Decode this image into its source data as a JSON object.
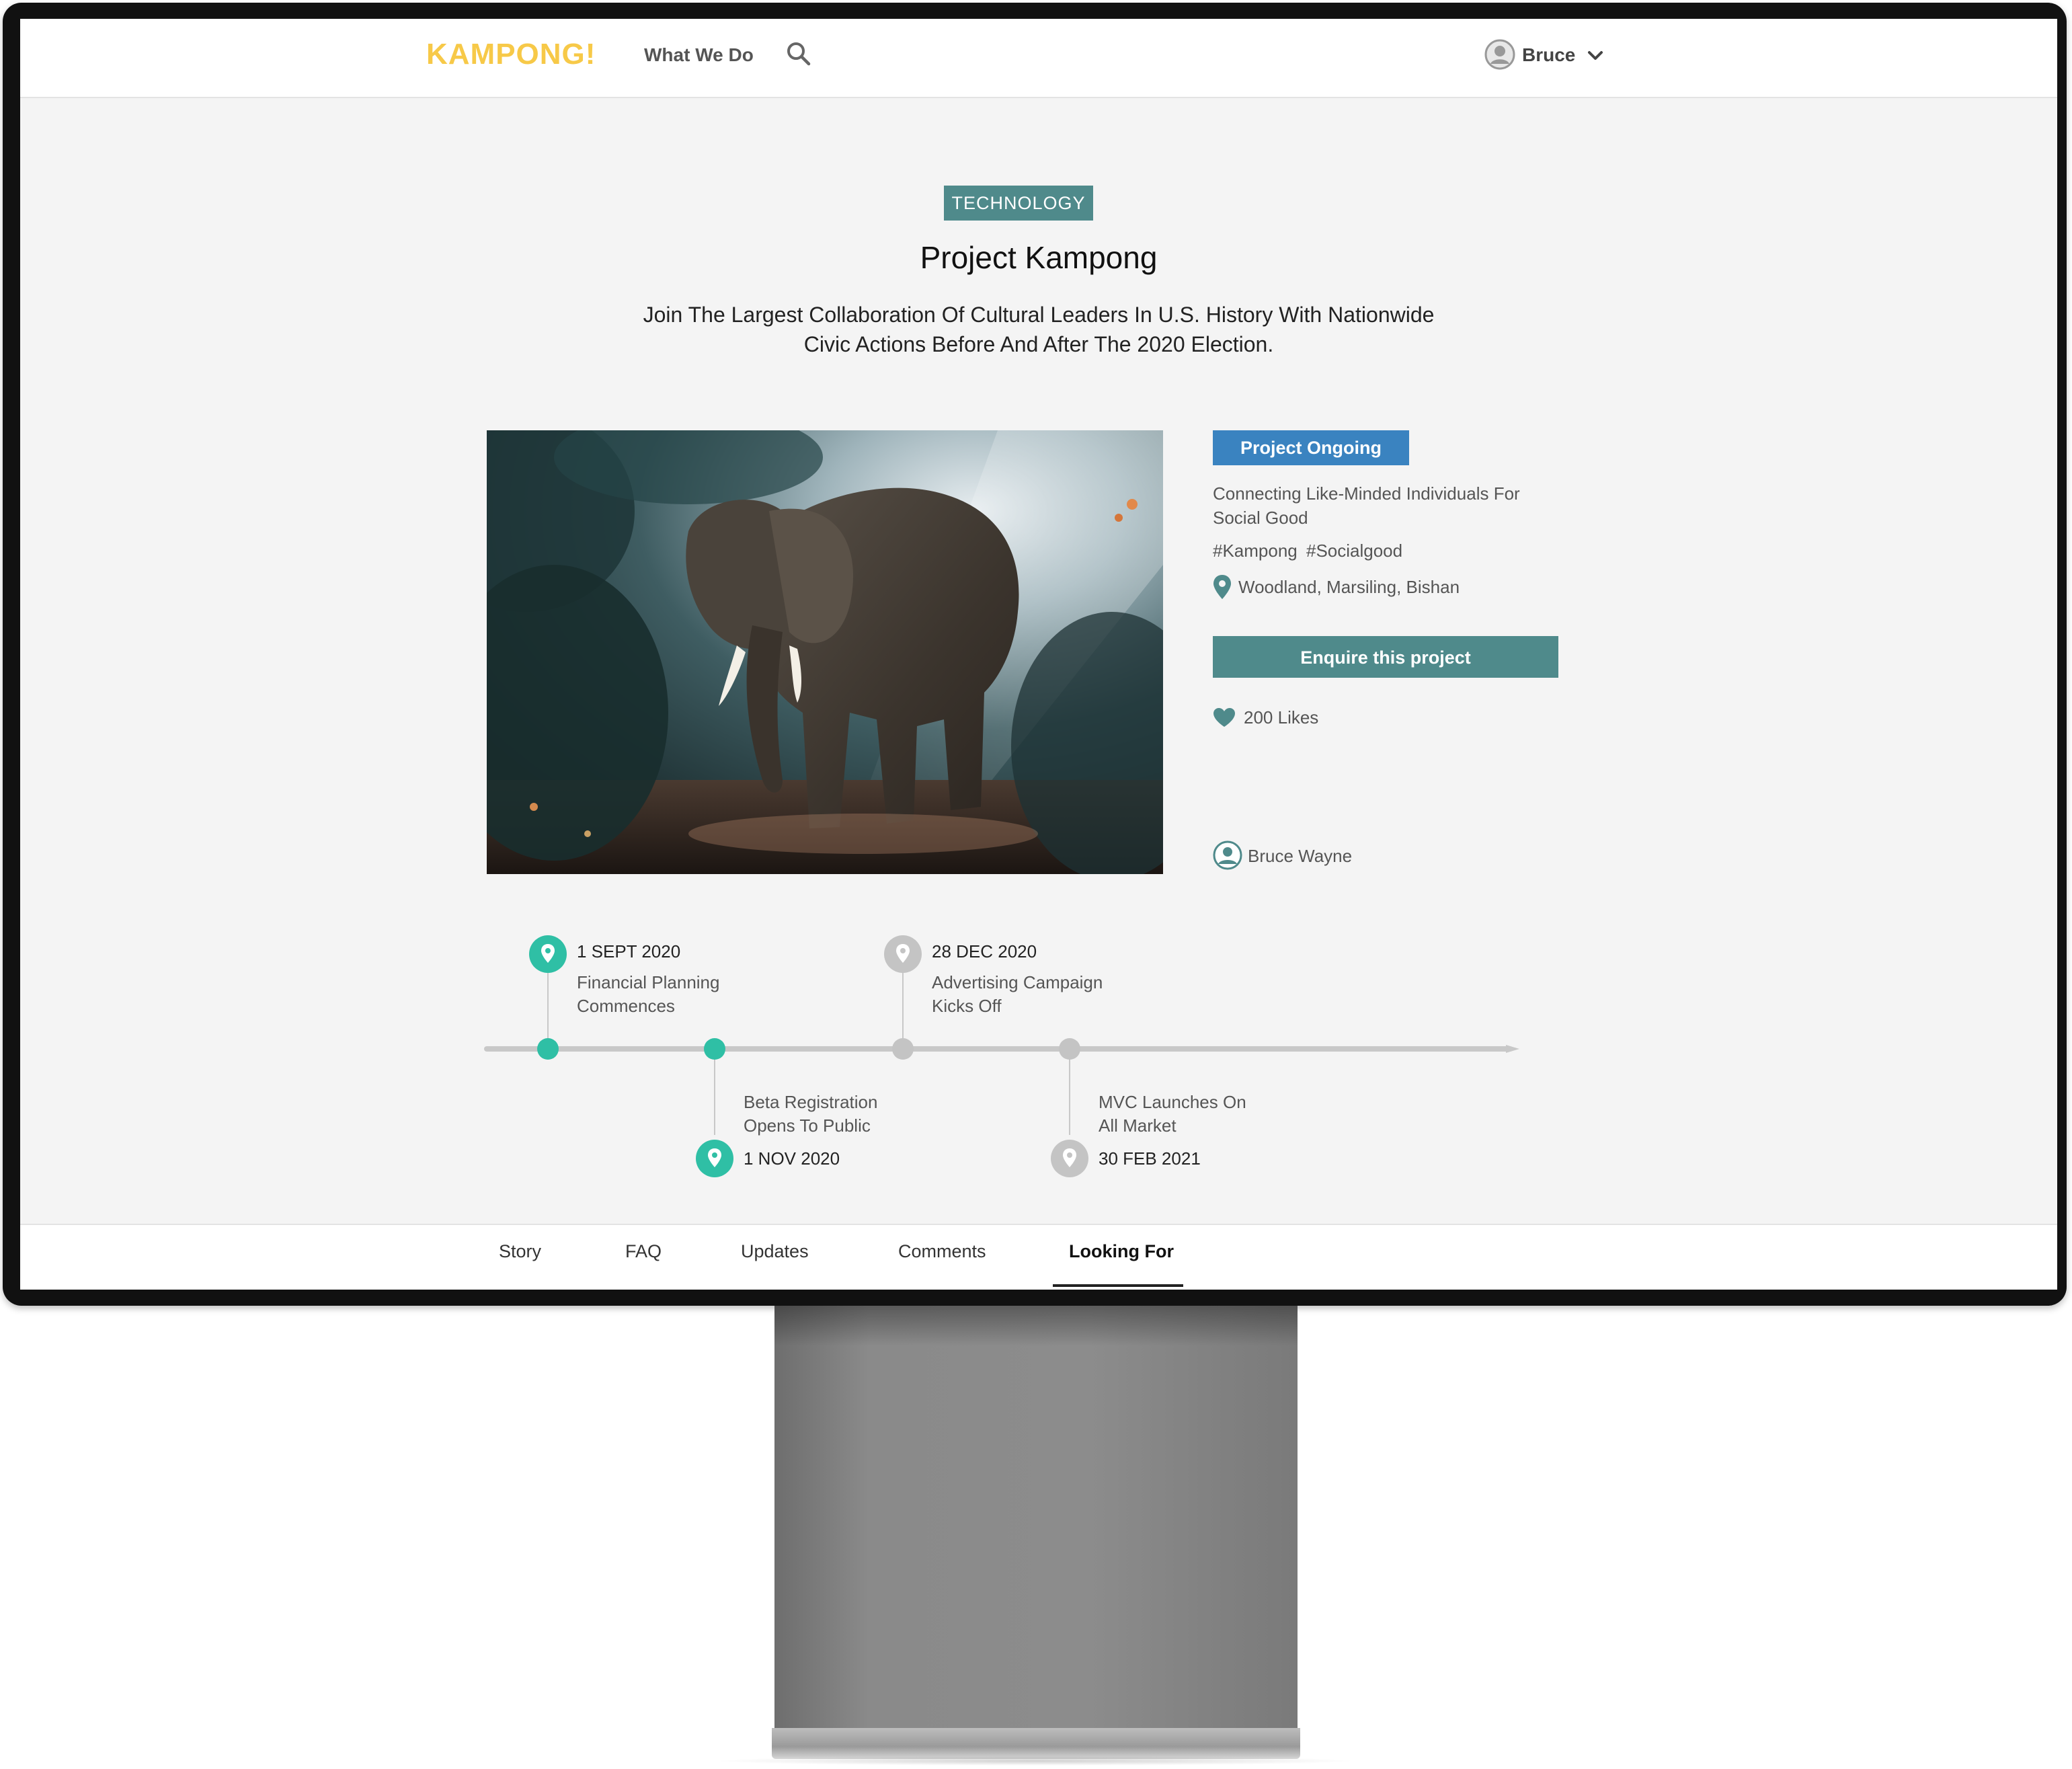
{
  "header": {
    "logo": "KAMPONG!",
    "nav_what_we_do": "What We Do",
    "user_name": "Bruce"
  },
  "hero": {
    "category_tag": "TECHNOLOGY",
    "title": "Project Kampong",
    "subtitle_line1": "Join The Largest Collaboration Of Cultural Leaders In U.S. History With Nationwide",
    "subtitle_line2": "Civic Actions Before And After The 2020 Election."
  },
  "project": {
    "status": "Project Ongoing",
    "description_line1": "Connecting Like-Minded Individuals For",
    "description_line2": "Social Good",
    "tags": "#Kampong  #Socialgood",
    "location": "Woodland, Marsiling, Bishan",
    "enquire_label": "Enquire this project",
    "likes": "200 Likes",
    "owner": "Bruce Wayne"
  },
  "timeline": [
    {
      "date": "1 SEPT 2020",
      "line1": "Financial Planning",
      "line2": "Commences",
      "done": true
    },
    {
      "date": "1 NOV 2020",
      "line1": "Beta Registration",
      "line2": "Opens To Public",
      "done": true
    },
    {
      "date": "28 DEC 2020",
      "line1": "Advertising Campaign",
      "line2": "Kicks Off",
      "done": false
    },
    {
      "date": "30 FEB 2021",
      "line1": "MVC Launches On",
      "line2": "All Market",
      "done": false
    }
  ],
  "tabs": [
    {
      "label": "Story"
    },
    {
      "label": "FAQ"
    },
    {
      "label": "Updates"
    },
    {
      "label": "Comments"
    },
    {
      "label": "Looking For"
    }
  ],
  "active_tab": "Looking For",
  "colors": {
    "brand_yellow": "#f7c948",
    "teal": "#4f8a8b",
    "status_blue": "#3a83c0",
    "timeline_done": "#2fbfa5",
    "timeline_pending": "#c4c4c4"
  }
}
